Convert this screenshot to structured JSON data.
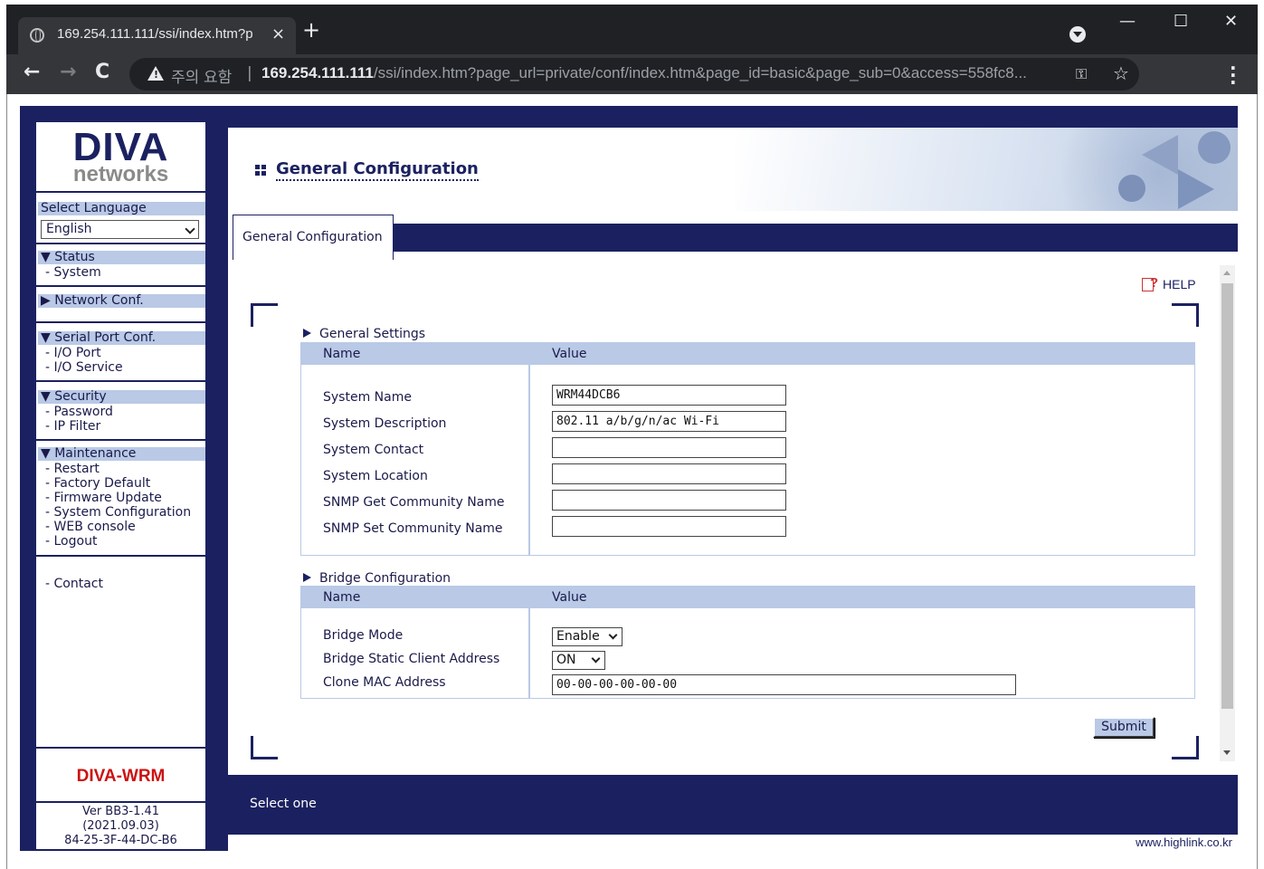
{
  "browser": {
    "tab_title": "169.254.111.111/ssi/index.htm?p",
    "tab_close": "×",
    "new_tab": "+",
    "security_label": "주의 요함",
    "url_separator": "|",
    "url_host": "169.254.111.111",
    "url_rest": "/ssi/index.htm?page_url=private/conf/index.htm&page_id=basic&page_sub=0&access=558fc8...",
    "icons": [
      "globe-icon",
      "back-icon",
      "forward-icon",
      "reload-icon",
      "warning-icon",
      "key-icon",
      "star-icon",
      "menu-icon",
      "minimize-icon",
      "maximize-icon",
      "close-icon"
    ]
  },
  "sidebar": {
    "logo_main": "DIVA",
    "logo_sub": "networks",
    "language_label": "Select Language",
    "language_value": "English",
    "sections": [
      {
        "header": "▼ Status",
        "items": [
          "- System"
        ]
      },
      {
        "header": "▶ Network Conf.",
        "items": []
      },
      {
        "header": "▼ Serial Port Conf.",
        "items": [
          "- I/O Port",
          "- I/O Service"
        ]
      },
      {
        "header": "▼ Security",
        "items": [
          "- Password",
          "- IP Filter"
        ]
      },
      {
        "header": "▼ Maintenance",
        "items": [
          "- Restart",
          "- Factory Default",
          "- Firmware Update",
          "- System Configuration",
          "- WEB console",
          "- Logout"
        ]
      }
    ],
    "contact": "-  Contact",
    "product": "DIVA-WRM",
    "version": "Ver BB3-1.41",
    "date": "(2021.09.03)",
    "mac": "84-25-3F-44-DC-B6"
  },
  "main": {
    "page_title": "General Configuration",
    "tab_label": "General Configuration",
    "help_label": "HELP",
    "general": {
      "title": "General Settings",
      "col_name": "Name",
      "col_value": "Value",
      "rows": [
        {
          "label": "System Name",
          "value": "WRM44DCB6"
        },
        {
          "label": "System Description",
          "value": "802.11 a/b/g/n/ac Wi-Fi"
        },
        {
          "label": "System Contact",
          "value": ""
        },
        {
          "label": "System Location",
          "value": ""
        },
        {
          "label": "SNMP Get Community Name",
          "value": ""
        },
        {
          "label": "SNMP Set Community Name",
          "value": ""
        }
      ]
    },
    "bridge": {
      "title": "Bridge Configuration",
      "col_name": "Name",
      "col_value": "Value",
      "bridge_mode_label": "Bridge Mode",
      "bridge_mode_value": "Enable",
      "static_client_label": "Bridge Static Client Address",
      "static_client_value": "ON",
      "clone_mac_label": "Clone MAC Address",
      "clone_mac_value": "00-00-00-00-00-00"
    },
    "submit_label": "Submit",
    "status_text": "Select one",
    "footer_url": "www.highlink.co.kr"
  },
  "colors": {
    "navy": "#1b2160",
    "header_blue": "#b9c9e6",
    "product_red": "#cc1111"
  }
}
